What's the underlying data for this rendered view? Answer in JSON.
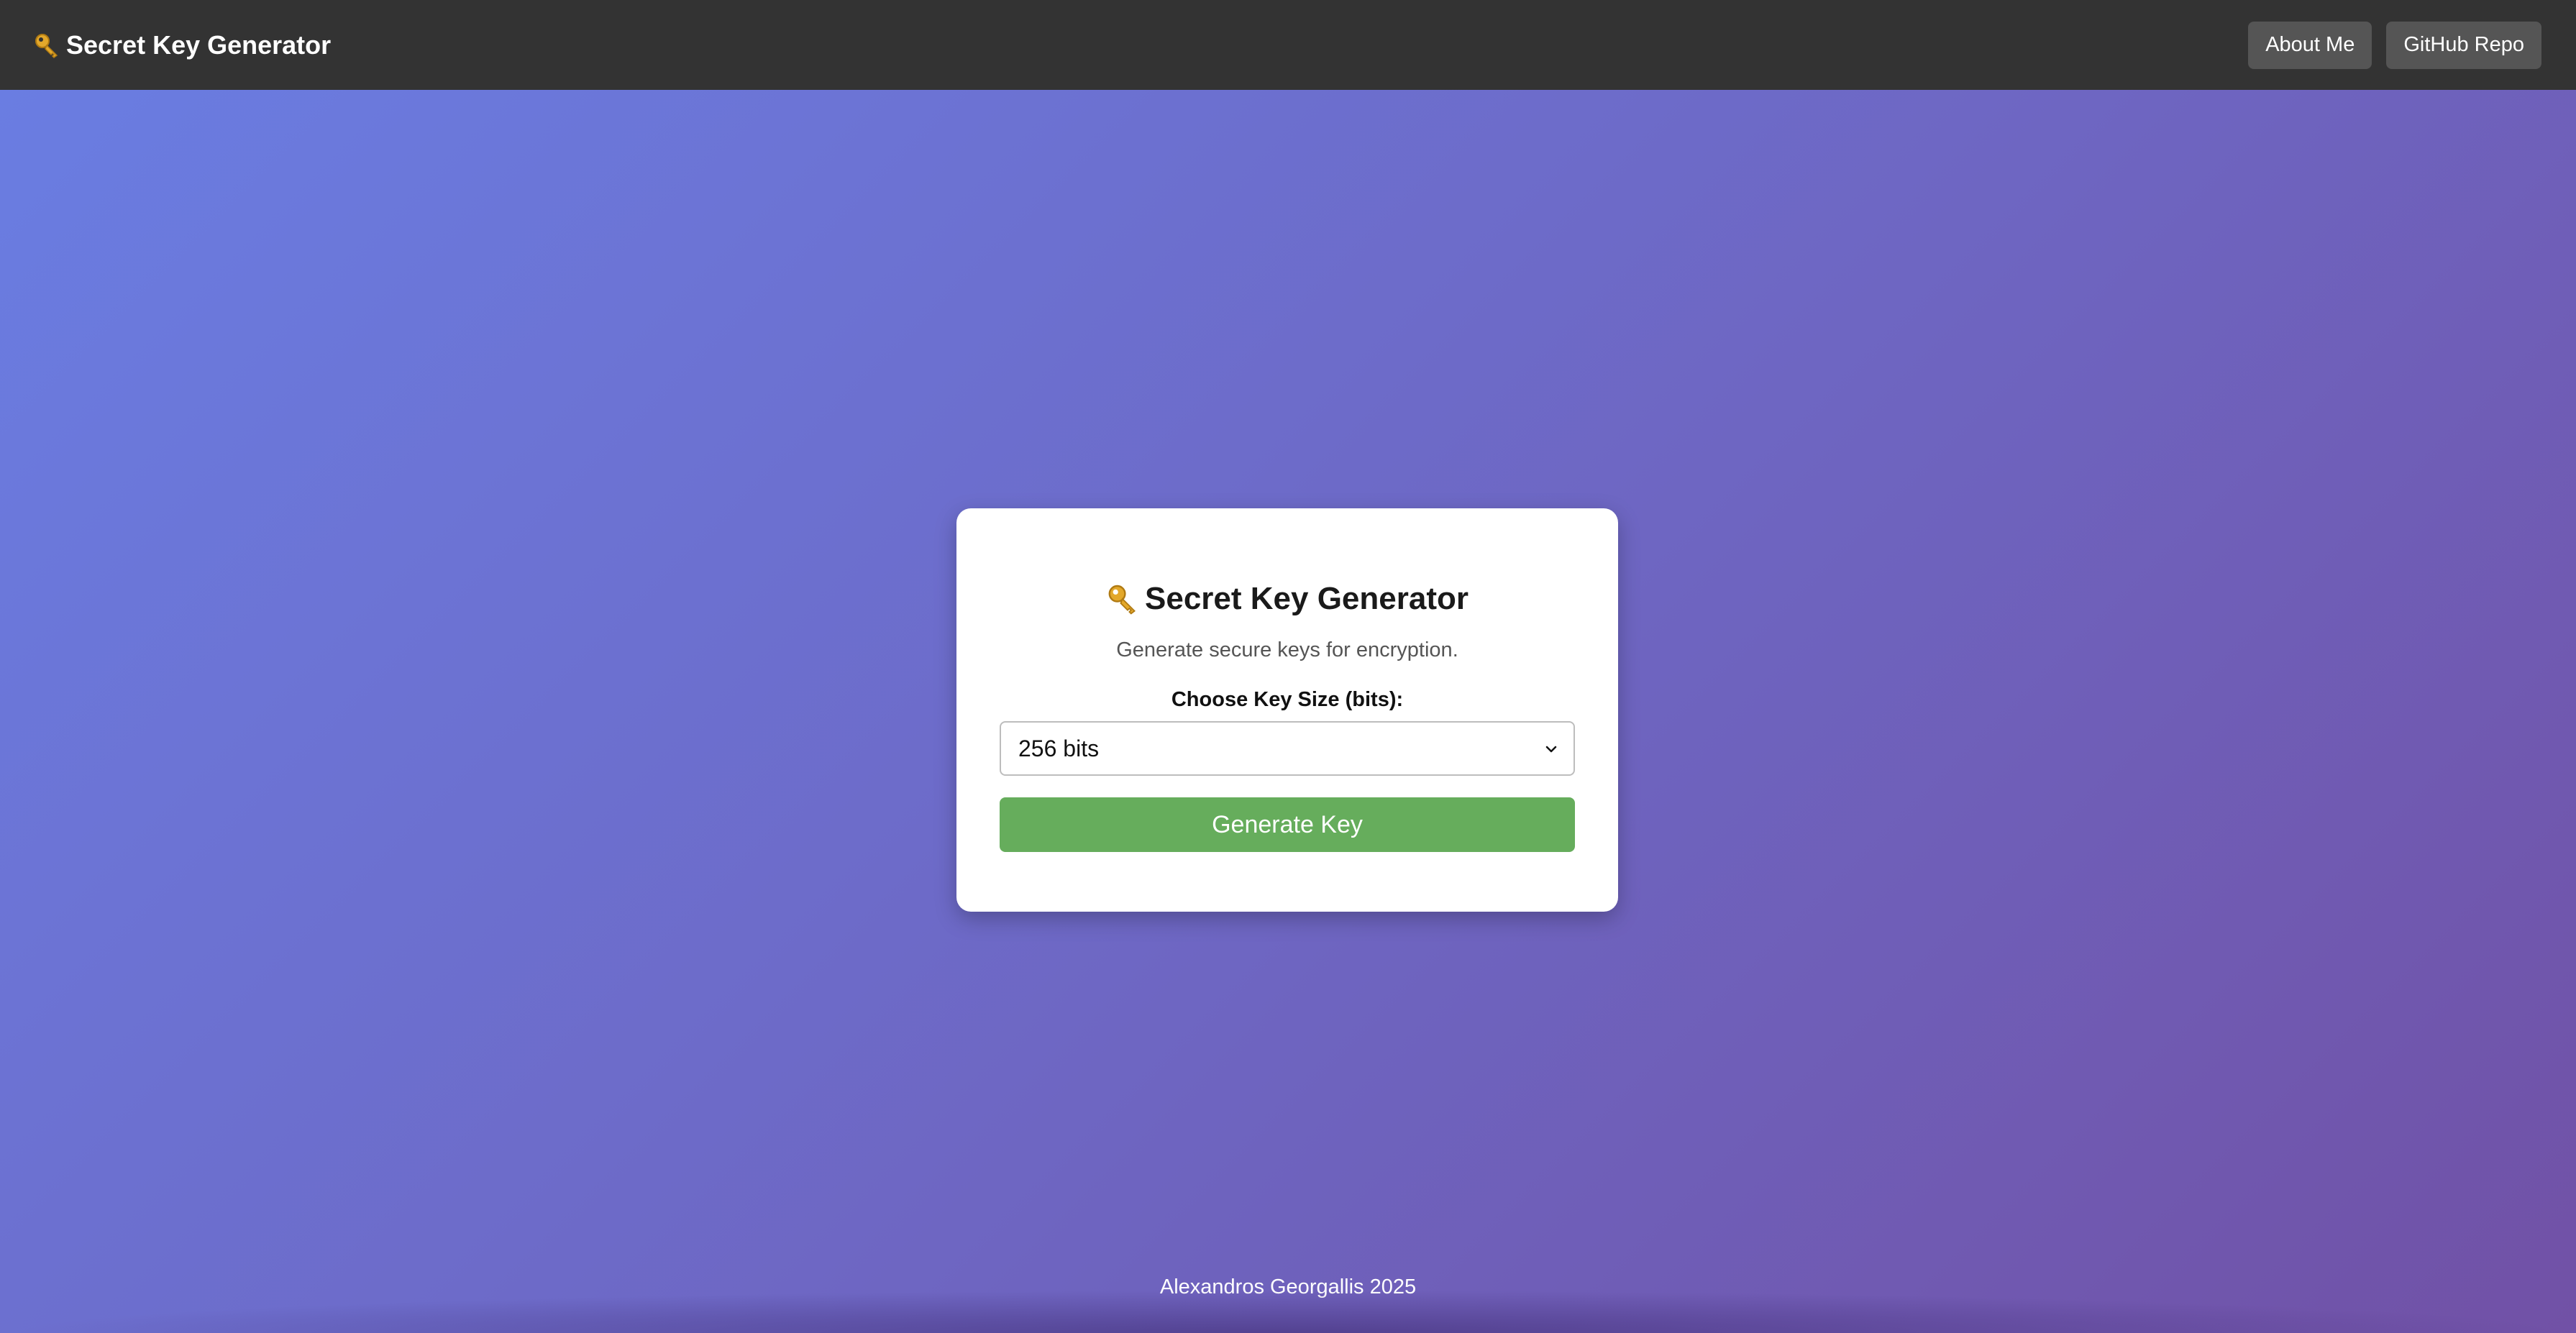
{
  "header": {
    "title": "Secret Key Generator",
    "nav": {
      "about_label": "About Me",
      "github_label": "GitHub Repo"
    }
  },
  "card": {
    "title": "Secret Key Generator",
    "subtitle": "Generate secure keys for encryption.",
    "key_size_label": "Choose Key Size (bits):",
    "key_size_selected": "256 bits",
    "generate_label": "Generate Key"
  },
  "footer": {
    "text": "Alexandros Georgallis 2025"
  },
  "colors": {
    "topbar": "#333333",
    "nav_button": "#555555",
    "generate_button": "#66ad5c",
    "gradient_start": "#6a7ee3",
    "gradient_end": "#7151a6"
  },
  "icons": {
    "brand": "key-icon",
    "card_title": "key-icon",
    "select": "chevron-down-icon"
  }
}
